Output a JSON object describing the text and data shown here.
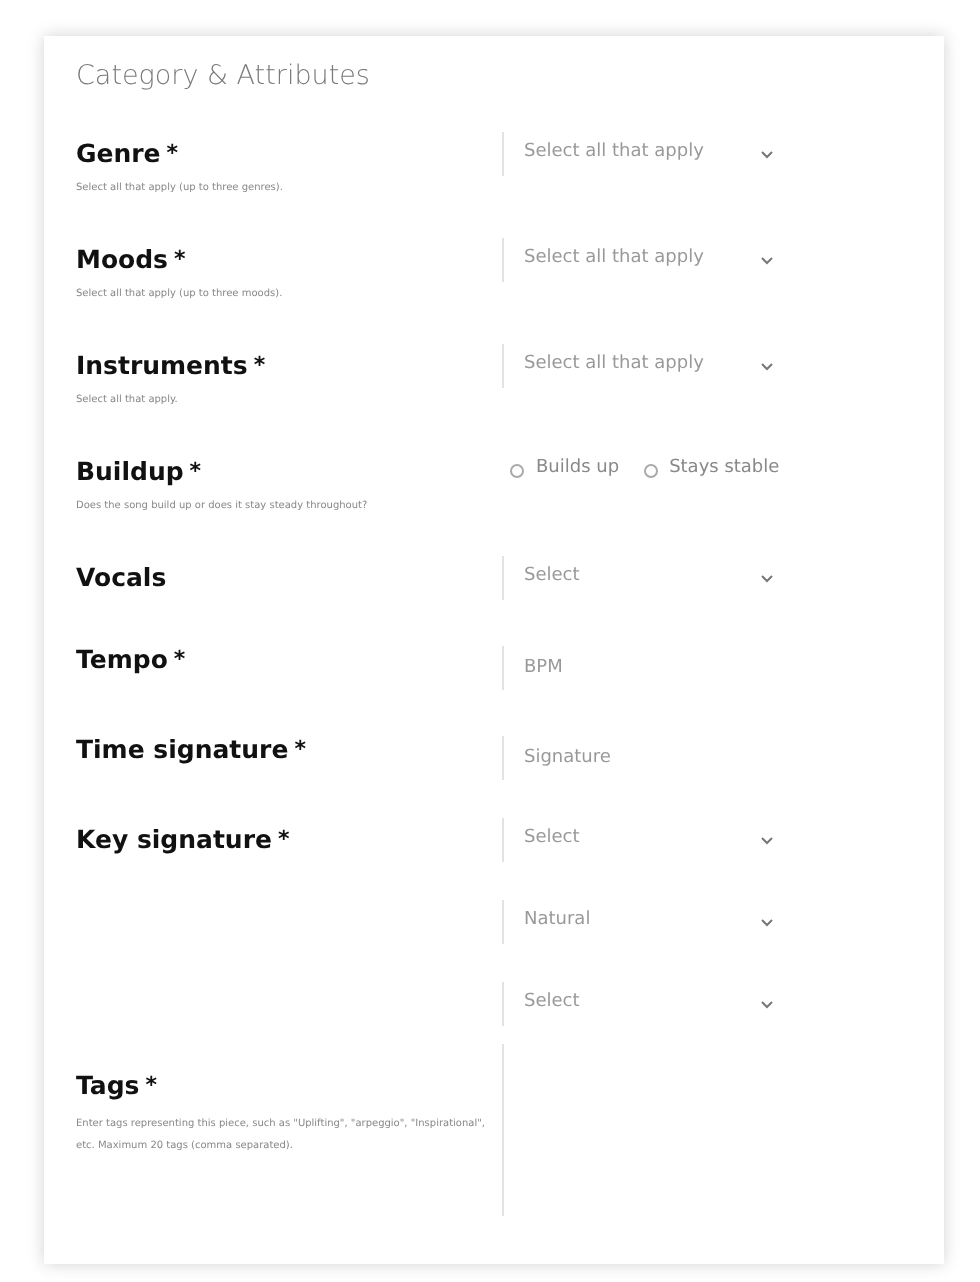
{
  "section_title": "Category & Attributes",
  "fields": [
    {
      "label": "Genre",
      "mark": "*",
      "hint": "Select all that apply (up to three genres).",
      "controls": [
        {
          "kind": "select",
          "placeholder": "Select all that apply"
        }
      ]
    },
    {
      "label": "Moods",
      "mark": "*",
      "hint": "Select all that apply (up to three moods).",
      "controls": [
        {
          "kind": "select",
          "placeholder": "Select all that apply"
        }
      ]
    },
    {
      "label": "Instruments",
      "mark": "*",
      "hint": "Select all that apply.",
      "controls": [
        {
          "kind": "select",
          "placeholder": "Select all that apply"
        }
      ]
    },
    {
      "label": "Buildup",
      "mark": "*",
      "hint": "Does the song build up or does it stay steady throughout?",
      "controls": [
        {
          "kind": "radio",
          "options": [
            {
              "label": "Builds up",
              "selected": false
            },
            {
              "label": "Stays stable",
              "selected": false
            }
          ]
        }
      ]
    },
    {
      "label": "Vocals",
      "controls": [
        {
          "kind": "select",
          "placeholder": "Select"
        }
      ]
    },
    {
      "label": "Tempo",
      "mark": "*",
      "controls": [
        {
          "kind": "text",
          "placeholder": "BPM"
        }
      ]
    },
    {
      "label": "Time signature",
      "mark": "*",
      "controls": [
        {
          "kind": "text",
          "placeholder": "Signature"
        }
      ]
    },
    {
      "label": "Key signature",
      "mark": "*",
      "controls": [
        {
          "kind": "select",
          "placeholder": "Select"
        },
        {
          "kind": "select",
          "placeholder": "Natural"
        },
        {
          "kind": "select",
          "placeholder": "Select"
        }
      ]
    },
    {
      "label": "Tags",
      "mark": "*",
      "hint": "Enter tags representing this piece, such as \"Uplifting\", \"arpeggio\", \"Inspirational\", etc. Maximum 20 tags (comma separated).",
      "controls": [
        {
          "kind": "textarea"
        }
      ]
    }
  ]
}
